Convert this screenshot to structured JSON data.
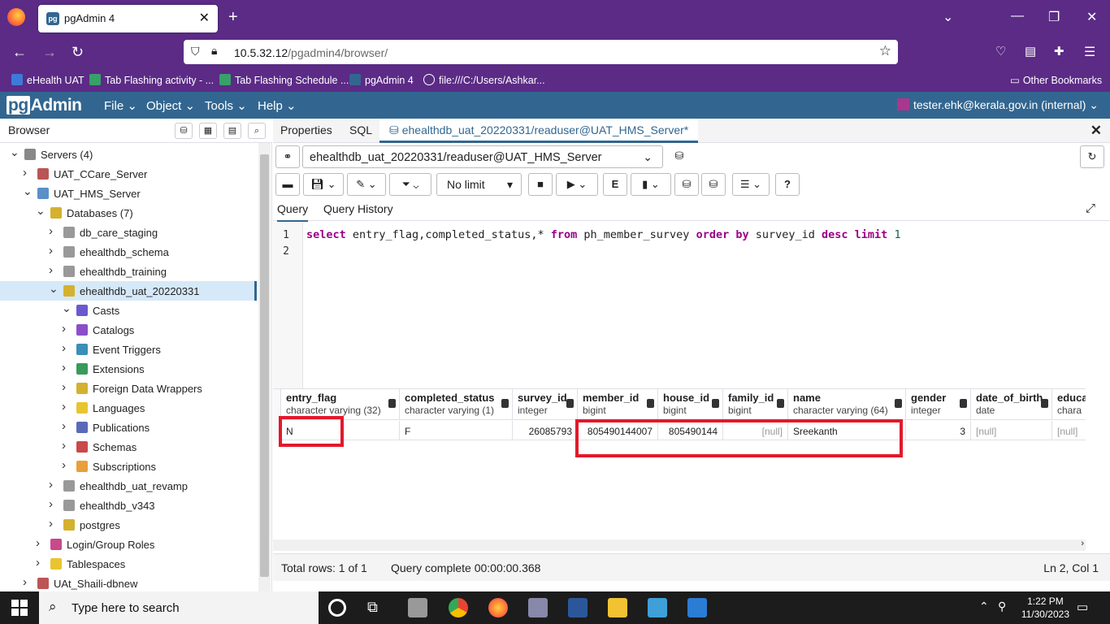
{
  "browser": {
    "tab_title": "pgAdmin 4",
    "url_host": "10.5.32.12",
    "url_path": "/pgadmin4/browser/",
    "bookmarks": [
      {
        "label": "eHealth UAT",
        "color": "#3d7bd8"
      },
      {
        "label": "Tab Flashing activity - ...",
        "color": "#38a169"
      },
      {
        "label": "Tab Flashing Schedule ...",
        "color": "#38a169"
      },
      {
        "label": "pgAdmin 4",
        "color": "#326690"
      },
      {
        "label": "file:///C:/Users/Ashkar...",
        "color": "#888888"
      }
    ],
    "other_bookmarks": "Other Bookmarks"
  },
  "pgadmin": {
    "logo_pg": "pg",
    "logo_admin": "Admin",
    "menus": [
      "File",
      "Object",
      "Tools",
      "Help"
    ],
    "user": "tester.ehk@kerala.gov.in (internal)"
  },
  "browser_panel": {
    "title": "Browser",
    "tree": [
      {
        "label": "Servers (4)",
        "level": 0,
        "state": "open",
        "icon": "servers-icon"
      },
      {
        "label": "UAT_CCare_Server",
        "level": 1,
        "state": "closed",
        "icon": "server-disconnected-icon"
      },
      {
        "label": "UAT_HMS_Server",
        "level": 1,
        "state": "open",
        "icon": "server-elephant-icon"
      },
      {
        "label": "Databases (7)",
        "level": 2,
        "state": "open",
        "icon": "databases-icon"
      },
      {
        "label": "db_care_staging",
        "level": 3,
        "state": "closed",
        "icon": "database-disconnected-icon"
      },
      {
        "label": "ehealthdb_schema",
        "level": 3,
        "state": "closed",
        "icon": "database-disconnected-icon"
      },
      {
        "label": "ehealthdb_training",
        "level": 3,
        "state": "closed",
        "icon": "database-disconnected-icon"
      },
      {
        "label": "ehealthdb_uat_20220331",
        "level": 3,
        "state": "open",
        "icon": "database-icon",
        "selected": true
      },
      {
        "label": "Casts",
        "level": 4,
        "state": "open",
        "icon": "casts-icon"
      },
      {
        "label": "Catalogs",
        "level": 4,
        "state": "closed",
        "icon": "catalogs-icon"
      },
      {
        "label": "Event Triggers",
        "level": 4,
        "state": "closed",
        "icon": "event-triggers-icon"
      },
      {
        "label": "Extensions",
        "level": 4,
        "state": "closed",
        "icon": "extensions-icon"
      },
      {
        "label": "Foreign Data Wrappers",
        "level": 4,
        "state": "closed",
        "icon": "fdw-icon"
      },
      {
        "label": "Languages",
        "level": 4,
        "state": "closed",
        "icon": "languages-icon"
      },
      {
        "label": "Publications",
        "level": 4,
        "state": "closed",
        "icon": "publications-icon"
      },
      {
        "label": "Schemas",
        "level": 4,
        "state": "closed",
        "icon": "schemas-icon"
      },
      {
        "label": "Subscriptions",
        "level": 4,
        "state": "closed",
        "icon": "subscriptions-icon"
      },
      {
        "label": "ehealthdb_uat_revamp",
        "level": 3,
        "state": "closed",
        "icon": "database-disconnected-icon"
      },
      {
        "label": "ehealthdb_v343",
        "level": 3,
        "state": "closed",
        "icon": "database-disconnected-icon"
      },
      {
        "label": "postgres",
        "level": 3,
        "state": "closed",
        "icon": "database-icon"
      },
      {
        "label": "Login/Group Roles",
        "level": 2,
        "state": "closed",
        "icon": "roles-icon"
      },
      {
        "label": "Tablespaces",
        "level": 2,
        "state": "closed",
        "icon": "tablespaces-icon"
      },
      {
        "label": "UAt_Shaili-dbnew",
        "level": 1,
        "state": "closed",
        "icon": "server-disconnected-icon"
      }
    ]
  },
  "query_tool": {
    "tabs": [
      "Properties",
      "SQL"
    ],
    "active_tab": "ehealthdb_uat_20220331/readuser@UAT_HMS_Server*",
    "connection": "ehealthdb_uat_20220331/readuser@UAT_HMS_Server",
    "limit": "No limit",
    "subtabs": [
      "Query",
      "Query History"
    ],
    "line_numbers": [
      "1",
      "2"
    ],
    "code": {
      "select": "select",
      "cols": " entry_flag,completed_status,* ",
      "from": "from",
      "table": " ph_member_survey ",
      "order_by": "order by",
      "col": " survey_id ",
      "desc": "desc",
      "limit": "limit",
      "limit_val": " 1"
    }
  },
  "results": {
    "columns": [
      {
        "name": "entry_flag",
        "type": "character varying (32)"
      },
      {
        "name": "completed_status",
        "type": "character varying (1)"
      },
      {
        "name": "survey_id",
        "type": "integer"
      },
      {
        "name": "member_id",
        "type": "bigint"
      },
      {
        "name": "house_id",
        "type": "bigint"
      },
      {
        "name": "family_id",
        "type": "bigint"
      },
      {
        "name": "name",
        "type": "character varying (64)"
      },
      {
        "name": "gender",
        "type": "integer"
      },
      {
        "name": "date_of_birth",
        "type": "date"
      },
      {
        "name": "educa",
        "type": "chara"
      }
    ],
    "row": [
      "N",
      "F",
      "26085793",
      "805490144007",
      "805490144",
      "[null]",
      "Sreekanth",
      "3",
      "[null]",
      "[null]"
    ],
    "highlight_color": "#e2192b"
  },
  "status": {
    "total_rows": "Total rows: 1 of 1",
    "query_time": "Query complete 00:00:00.368",
    "cursor": "Ln 2, Col 1"
  },
  "taskbar": {
    "search_placeholder": "Type here to search",
    "time": "1:22 PM",
    "date": "11/30/2023"
  }
}
